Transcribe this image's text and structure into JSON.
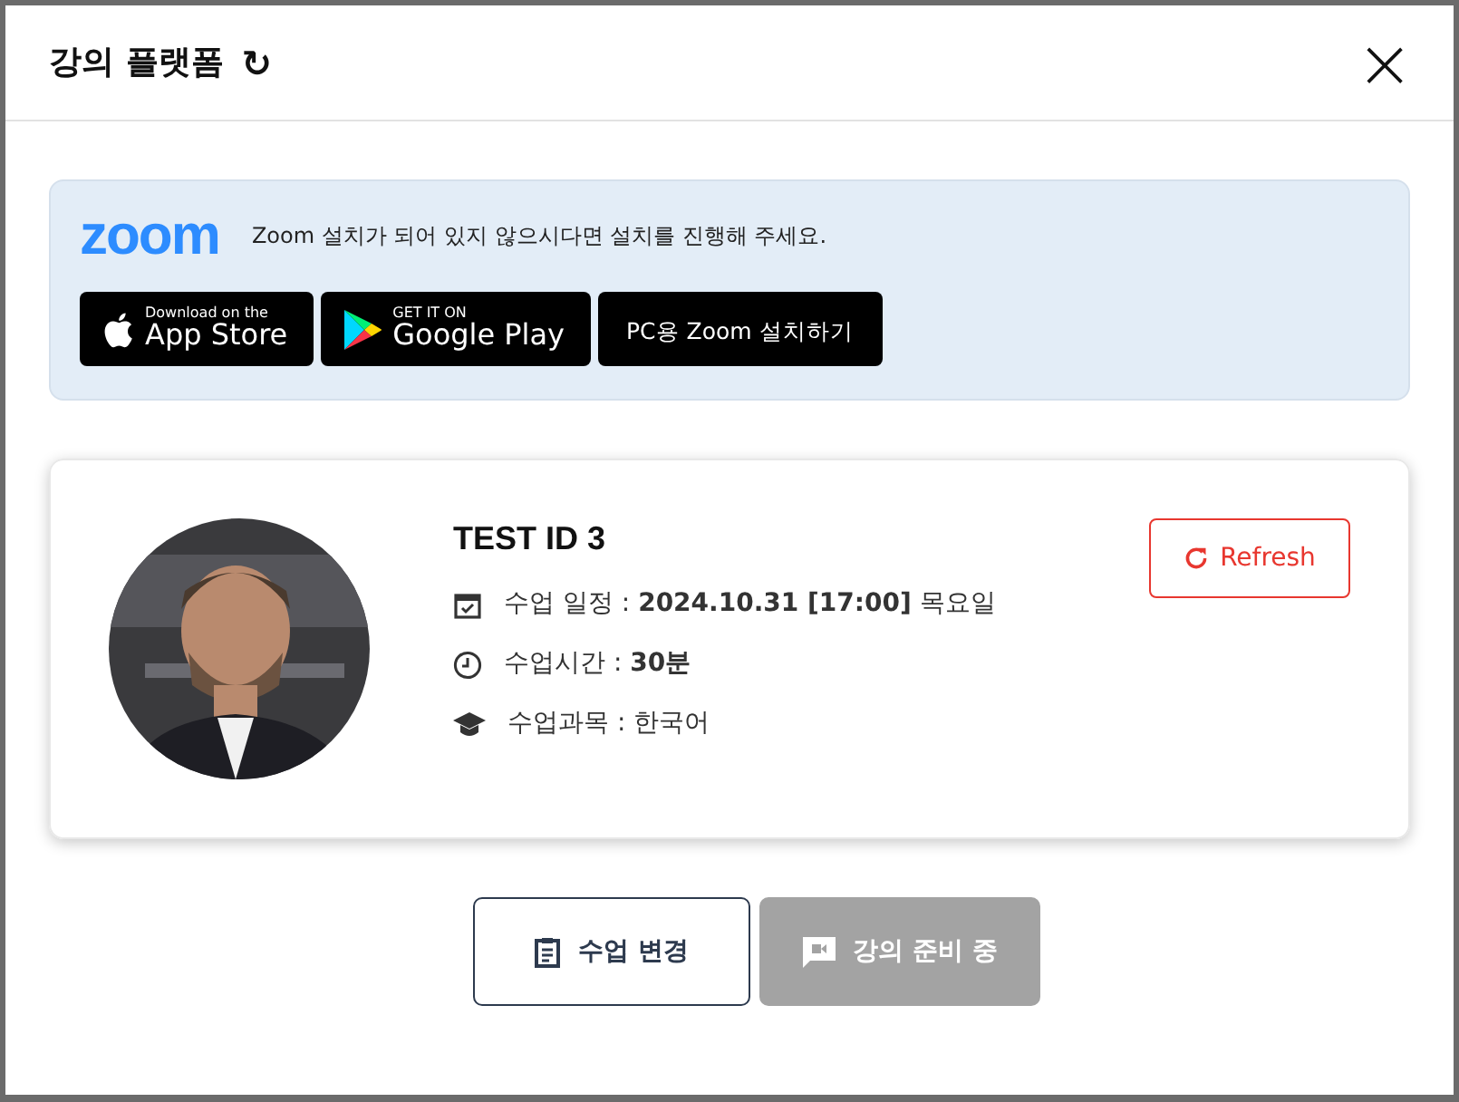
{
  "dialog": {
    "title": "강의 플랫폼",
    "refresh_symbol": "↻",
    "close_symbol": "×"
  },
  "zoom_panel": {
    "logo": "zoom",
    "message": "Zoom 설치가 되어 있지 않으시다면 설치를 진행해 주세요.",
    "store_buttons": [
      {
        "kind": "apple",
        "small": "Download on the",
        "large": "App Store"
      },
      {
        "kind": "google",
        "small": "GET IT ON",
        "large": "Google Play"
      },
      {
        "kind": "plain",
        "large": "PC용 Zoom 설치하기"
      }
    ]
  },
  "lesson": {
    "name": "TEST ID 3",
    "refresh_button": "Refresh",
    "details": [
      {
        "kind": "calendar",
        "text": "수업 일정 : **2024.10.31 [17:00]** 목요일"
      },
      {
        "kind": "clock",
        "text": "수업시간 : **30분**"
      },
      {
        "kind": "subject",
        "text": "수업과목 : 한국어"
      }
    ]
  },
  "actions": [
    {
      "kind": "change",
      "label": "수업 변경",
      "disabled": false
    },
    {
      "kind": "enter",
      "label": "강의 준비 중",
      "disabled": true
    }
  ]
}
